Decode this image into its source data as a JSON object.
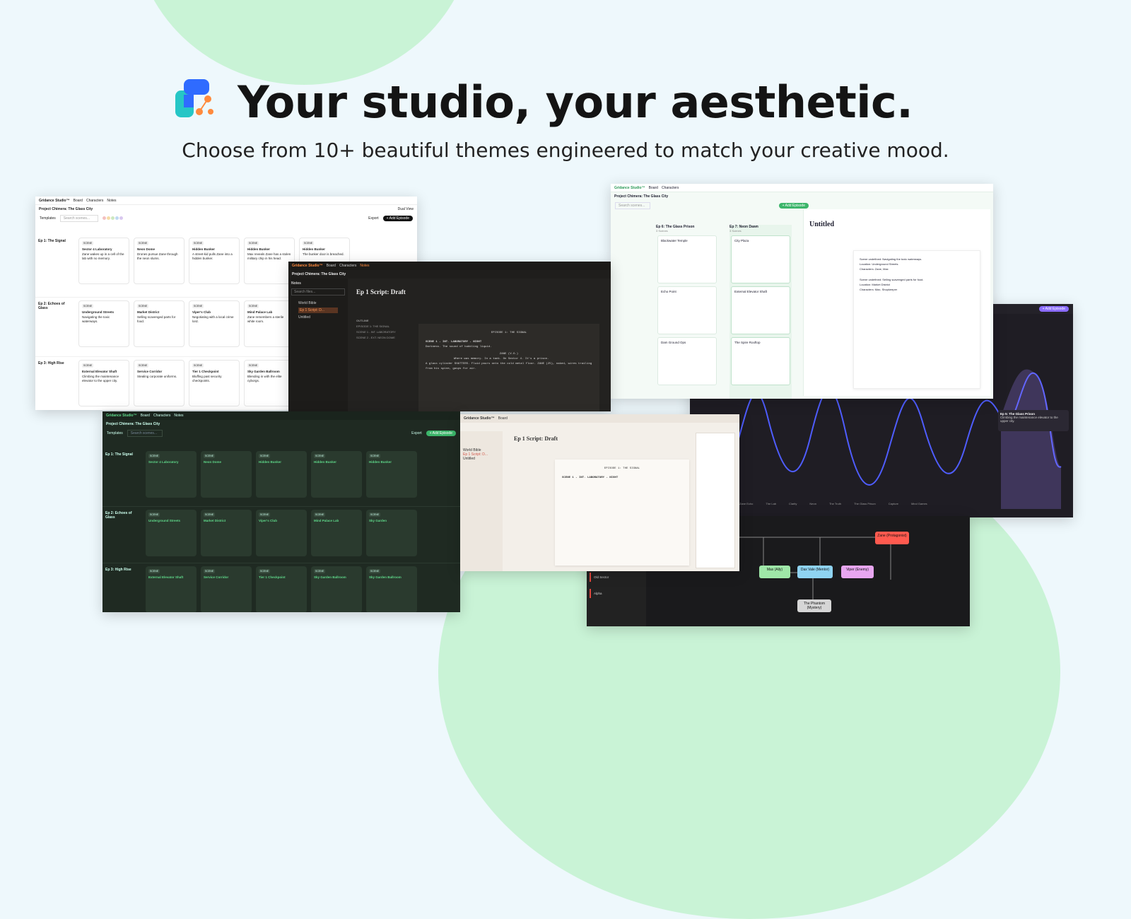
{
  "hero": {
    "headline": "Your studio, your aesthetic.",
    "subheadline": "Choose from 10+ beautiful themes engineered to match your creative mood."
  },
  "colors": {
    "background": "#eef8fc",
    "blob": "#c9f3d6",
    "logo_blue": "#2f6bff",
    "logo_teal": "#26c6c6",
    "logo_orange": "#ff8a3d"
  },
  "app": {
    "brand": "Gridance Studio™",
    "nav": [
      "Board",
      "Characters",
      "Notes"
    ],
    "project": "Project Chimera: The Glass City",
    "templates": "Templates",
    "search_placeholder": "Search scenes...",
    "export": "Export",
    "add_episode": "+ Add Episode",
    "dual_view": "Dual View"
  },
  "light_board": {
    "rows": [
      {
        "label": "Ep 1: The Signal",
        "cards": [
          {
            "title": "Sector 4 Laboratory",
            "desc": "Zane wakes up in a cell of the lab with no memory."
          },
          {
            "title": "Neon Dome",
            "desc": "Drones pursue Zane through the neon slums."
          },
          {
            "title": "Hidden Bunker",
            "desc": "A street-kid pulls Zane into a hidden bunker."
          },
          {
            "title": "Hidden Bunker",
            "desc": "Max reveals Zane has a stolen military chip in his head."
          },
          {
            "title": "Hidden Bunker",
            "desc": "The bunker door is breached."
          }
        ]
      },
      {
        "label": "Ep 2: Echoes of Glass",
        "cards": [
          {
            "title": "Underground Streets",
            "desc": "Navigating the toxic waterways."
          },
          {
            "title": "Market District",
            "desc": "Selling scavenged parts for food."
          },
          {
            "title": "Viper's Club",
            "desc": "Negotiating with a local crime lord."
          },
          {
            "title": "Mind Palace Lab",
            "desc": "Zane remembers a sterile white room."
          }
        ]
      },
      {
        "label": "Ep 3: High Rise",
        "cards": [
          {
            "title": "External Elevator Shaft",
            "desc": "Climbing the maintenance elevator to the upper city."
          },
          {
            "title": "Service Corridor",
            "desc": "Stealing corporate uniforms."
          },
          {
            "title": "Tier 1 Checkpoint",
            "desc": "Bluffing past security checkpoints."
          },
          {
            "title": "Sky Garden Ballroom",
            "desc": "Blending in with the elite cyborgs."
          }
        ]
      }
    ]
  },
  "script_dark": {
    "title": "Ep 1 Script: Draft",
    "notes_label": "Notes",
    "search": "Search files...",
    "files": [
      "World Bible",
      "Ep 1 Script: D...",
      "Untitled"
    ],
    "outline_label": "OUTLINE",
    "outline": [
      "EPISODE 1: THE SIGNAL",
      "SCENE 1 - INT. LABORATORY",
      "SCENE 2 - EXT. NEON DOME"
    ],
    "episode_heading": "EPISODE 1: THE SIGNAL",
    "scene_heading": "SCENE 1 - INT. LABORATORY - NIGHT",
    "action": "Darkness. The sound of bubbling liquid.",
    "character": "ZANE (V.O.)",
    "dialogue": "Where was memory. In a tank. On Sector 4. It's a prison.",
    "action2": "A glass cylinder SHATTERS. Fluid pours onto the cold metal floor. ZANE (25), naked, wires trailing from his spine, gasps for air."
  },
  "kanban_light": {
    "columns": [
      {
        "title": "Ep 6: The Glass Prison",
        "sub": "3 Scenes",
        "cards": [
          "Blackwater Temple",
          "Echo Point",
          "Dam Ground Ops"
        ]
      },
      {
        "title": "Ep 7: Neon Dawn",
        "sub": "3 Scenes",
        "cards": [
          "City Plaza",
          "External Elevator Shaft",
          "The Spire Rooftop"
        ]
      }
    ],
    "editor_title": "Untitled",
    "editor_lines": [
      "Scene undefined: Navigating the toxic waterways.",
      "Location: Underground Streets",
      "Characters: Zane, Max",
      "Scene undefined: Selling scavenged parts for food.",
      "Location: Market District",
      "Characters: Max, Shopkeeper"
    ]
  },
  "green_board": {
    "rows": [
      {
        "label": "Ep 1: The Signal",
        "cards": [
          "Sector 4 Laboratory",
          "Neon Dome",
          "Hidden Bunker",
          "Hidden Bunker",
          "Hidden Bunker"
        ]
      },
      {
        "label": "Ep 2: Echoes of Glass",
        "cards": [
          "Underground Streets",
          "Market District",
          "Viper's Club",
          "Mind Palace Lab",
          "Sky Garden"
        ]
      },
      {
        "label": "Ep 3: High Rise",
        "cards": [
          "External Elevator Shaft",
          "Service Corridor",
          "Tier 1 Checkpoint",
          "Sky Garden Ballroom",
          "Sky Garden Ballroom"
        ]
      }
    ]
  },
  "script_warm": {
    "title": "Ep 1 Script: Draft",
    "heading": "EPISODE 1: THE SIGNAL",
    "scene": "SCENE 1 - INT. LABORATORY - NIGHT"
  },
  "graph_dark": {
    "tooltip_title": "Ep 5: The Glass Prison",
    "tooltip_sub": "Climbing the maintenance elevator to the upper city.",
    "add_episode": "+ Add Episode",
    "labels": [
      "Zane Echo",
      "The Lab",
      "Clarity",
      "Neon",
      "The Truth",
      "The Glass Prison",
      "Capture",
      "Mind Games"
    ]
  },
  "map_dark": {
    "nodes": [
      "Zane (Protagonist)",
      "Dax Vale (Mentor)",
      "Viper (Enemy)",
      "The Phantom (Mystery)",
      "Max (Ally)"
    ],
    "side": [
      "Old Sector",
      "Alpha"
    ]
  }
}
